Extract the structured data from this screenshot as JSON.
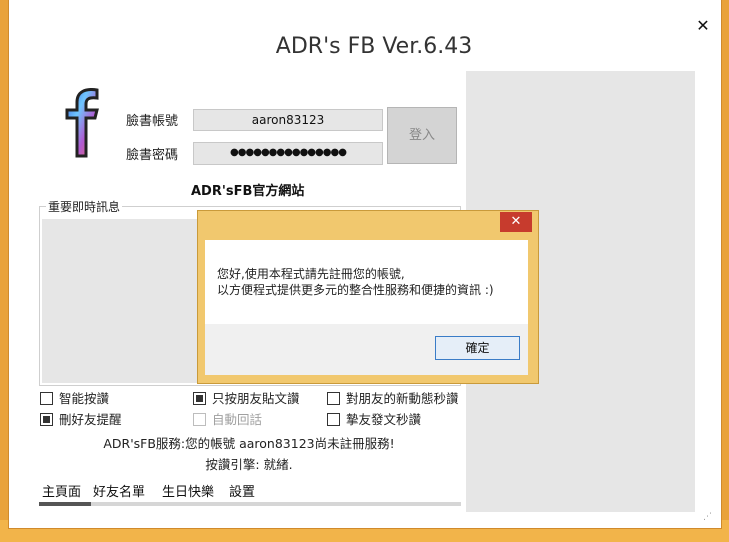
{
  "window": {
    "title": "ADR's FB Ver.6.43",
    "close_glyph": "✕"
  },
  "logo": {
    "glyph": "f",
    "icon": "facebook-logo-icon"
  },
  "login": {
    "account_label": "臉書帳號",
    "account_value": "aaron83123",
    "password_label": "臉書密碼",
    "password_value": "●●●●●●●●●●●●●●●",
    "login_button": "登入"
  },
  "site_link": "ADR'sFB官方網站",
  "news": {
    "title": "重要即時訊息"
  },
  "options": {
    "smart_like": {
      "label": "智能按讚",
      "checked": false
    },
    "friend_posts_only": {
      "label": "只按朋友貼文讚",
      "checked": true
    },
    "friend_updates_instant": {
      "label": "對朋友的新動態秒讚",
      "checked": false
    },
    "unfriend_alert": {
      "label": "刪好友提醒",
      "checked": true
    },
    "auto_reply": {
      "label": "自動回話",
      "checked": false,
      "disabled": true
    },
    "close_friend_instant": {
      "label": "摯友發文秒讚",
      "checked": false
    }
  },
  "status": {
    "service": "ADR'sFB服務:您的帳號 aaron83123尚未註冊服務!",
    "engine": "按讚引擎: 就緒."
  },
  "tabs": [
    "主頁面",
    "好友名單",
    "生日快樂",
    "設置"
  ],
  "dialog": {
    "close_glyph": "✕",
    "message_line1": "您好,使用本程式請先註冊您的帳號,",
    "message_line2": "以方便程式提供更多元的整合性服務和便捷的資訊 :)",
    "ok_button": "確定"
  },
  "colors": {
    "desktop": "#e9a23a",
    "dialog_frame": "#f1c86e",
    "dialog_close": "#c73b2d",
    "ok_border": "#3a7cc7"
  }
}
